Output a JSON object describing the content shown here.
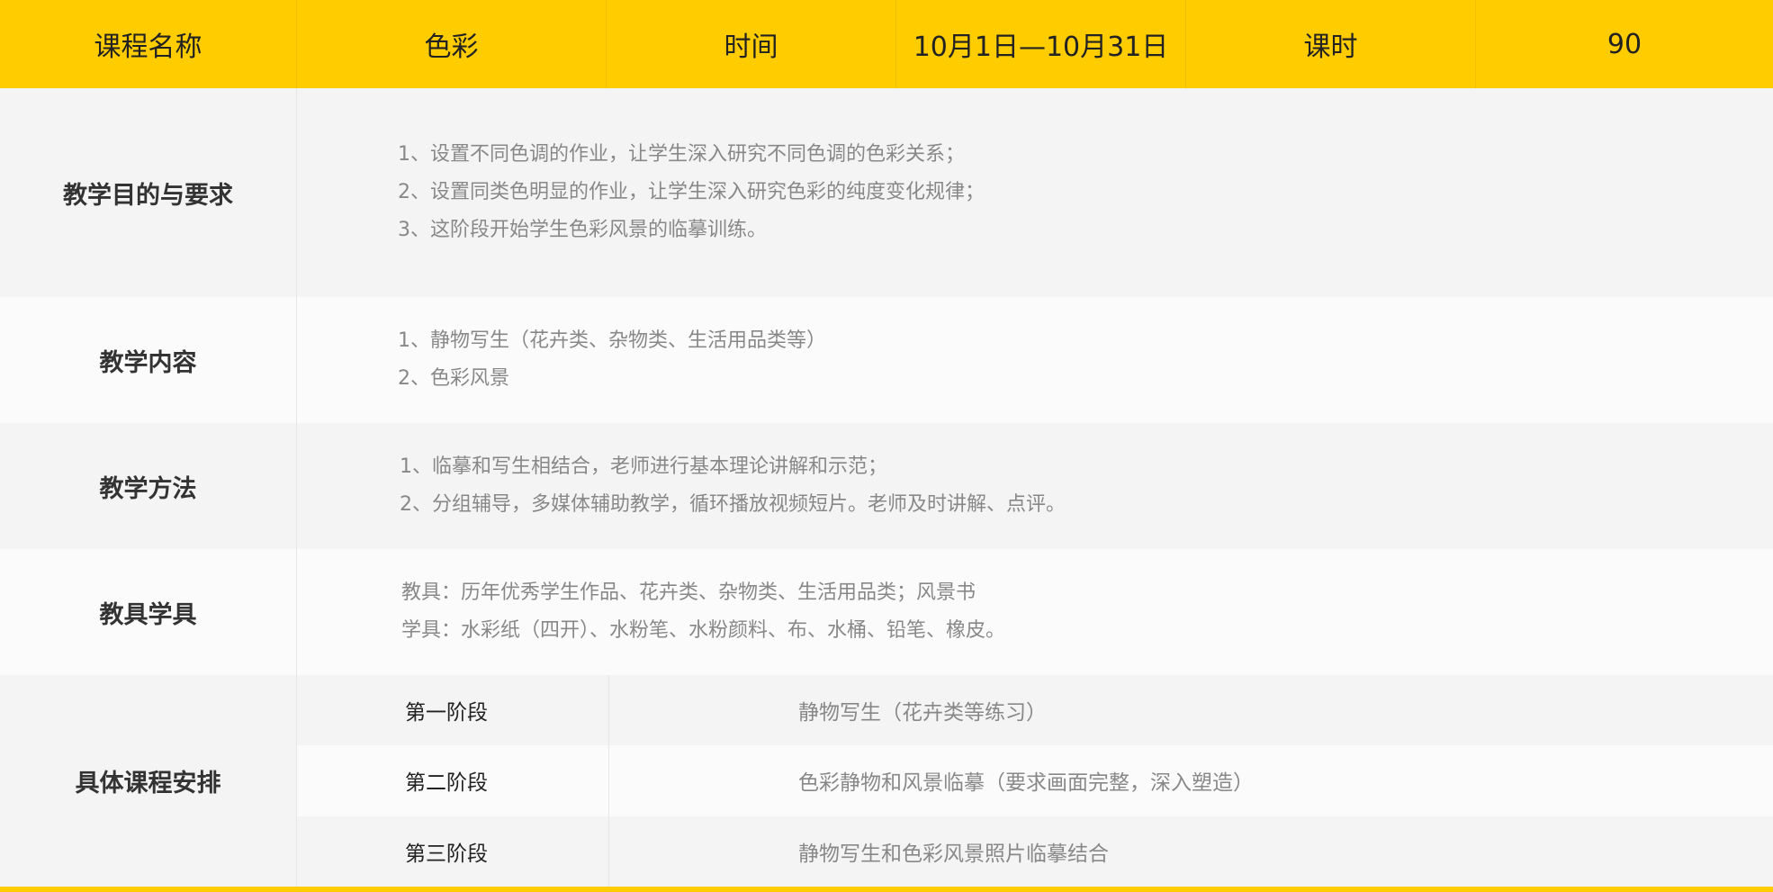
{
  "header": {
    "cells": [
      "课程名称",
      "色彩",
      "时间",
      "10月1日—10月31日",
      "课时",
      "90"
    ]
  },
  "objectives": {
    "label": "教学目的与要求",
    "lines": [
      "1、设置不同色调的作业，让学生深入研究不同色调的色彩关系；",
      "2、设置同类色明显的作业，让学生深入研究色彩的纯度变化规律；",
      "3、这阶段开始学生色彩风景的临摹训练。"
    ]
  },
  "content": {
    "label": "教学内容",
    "lines": [
      "1、静物写生（花卉类、杂物类、生活用品类等）",
      "2、色彩风景"
    ]
  },
  "method": {
    "label": "教学方法",
    "lines": [
      "1、临摹和写生相结合，老师进行基本理论讲解和示范；",
      "2、分组辅导，多媒体辅助教学，循环播放视频短片。老师及时讲解、点评。"
    ]
  },
  "tools": {
    "label": "教具学具",
    "lines": [
      "教具：历年优秀学生作品、花卉类、杂物类、生活用品类；风景书",
      "学具：水彩纸（四开）、水粉笔、水粉颜料、布、水桶、铅笔、橡皮。"
    ]
  },
  "schedule": {
    "label": "具体课程安排",
    "stages": [
      {
        "stage": "第一阶段",
        "desc": "静物写生（花卉类等练习）"
      },
      {
        "stage": "第二阶段",
        "desc": "色彩静物和风景临摹（要求画面完整，深入塑造）"
      },
      {
        "stage": "第三阶段",
        "desc": "静物写生和色彩风景照片临摹结合"
      }
    ]
  },
  "colors": {
    "accent": "#ffcc00",
    "row_alt": "#f4f4f4",
    "row": "#fbfbfb"
  }
}
